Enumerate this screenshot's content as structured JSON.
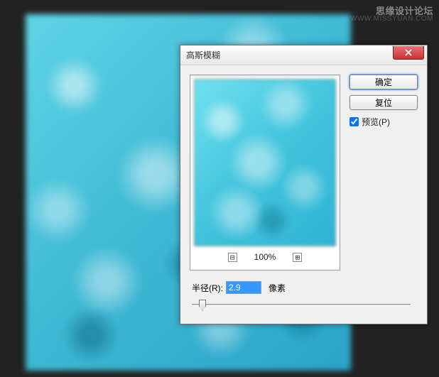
{
  "watermark": {
    "main": "思缘设计论坛",
    "sub": "WWW.MISSYUAN.COM"
  },
  "dialog": {
    "title": "高斯模糊",
    "buttons": {
      "ok": "确定",
      "cancel": "复位"
    },
    "preview_label": "预览(P)",
    "preview_checked": true,
    "zoom": {
      "out": "⊟",
      "pct": "100%",
      "in": "⊞"
    },
    "radius": {
      "label": "半径(R):",
      "value": "2.9",
      "unit": "像素"
    }
  }
}
